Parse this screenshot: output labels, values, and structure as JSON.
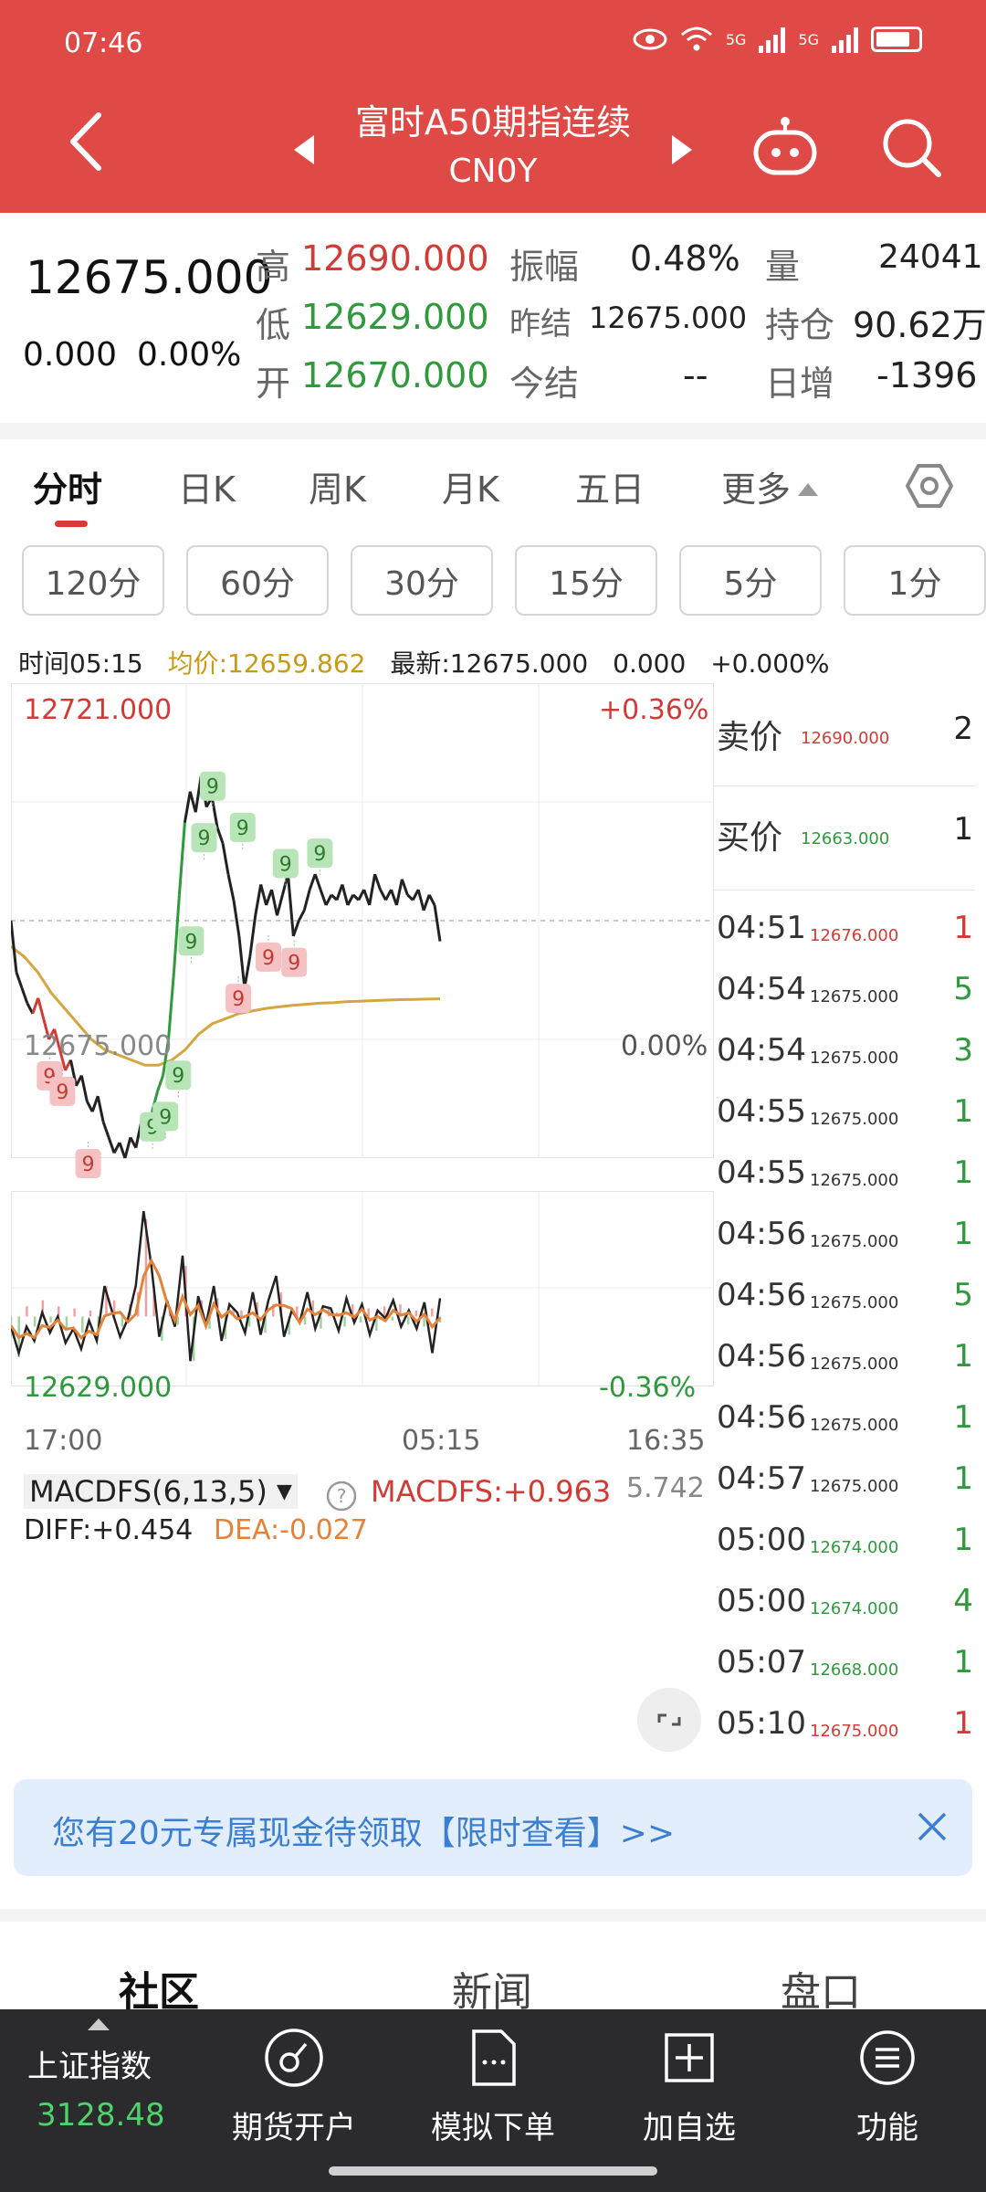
{
  "status_bar": {
    "time": "07:46",
    "net1": "5G",
    "net2": "5G"
  },
  "header": {
    "title": "富时A50期指连续",
    "code": "CN0Y"
  },
  "quote": {
    "last": "12675.000",
    "change": "0.000",
    "change_pct": "0.00%",
    "high_label": "高",
    "high": "12690.000",
    "low_label": "低",
    "low": "12629.000",
    "open_label": "开",
    "open": "12670.000",
    "amp_label": "振幅",
    "amp": "0.48%",
    "prev_settle_label": "昨结",
    "prev_settle": "12675.000",
    "settle_label": "今结",
    "settle": "--",
    "vol_label": "量",
    "vol": "24041",
    "oi_label": "持仓",
    "oi": "90.62万",
    "oi_chg_label": "日增",
    "oi_chg": "-1396"
  },
  "tabs": [
    "分时",
    "日K",
    "周K",
    "月K",
    "五日",
    "更多"
  ],
  "periods": [
    "120分",
    "60分",
    "30分",
    "15分",
    "5分",
    "1分"
  ],
  "info_line": {
    "time": "时间05:15",
    "avg": "均价:12659.862",
    "latest": "最新:12675.000",
    "chg": "0.000",
    "pct": "+0.000%"
  },
  "chart": {
    "price_high": "12721.000",
    "price_mid": "12675.000",
    "price_low": "12629.000",
    "pct_high": "+0.36%",
    "pct_mid": "0.00%",
    "pct_low": "-0.36%",
    "time_start": "17:00",
    "time_mid": "05:15",
    "time_end": "16:35",
    "macd_name": "MACDFS(6,13,5)",
    "macd_val": "MACDFS:+0.963",
    "macd_max": "5.742",
    "diff": "DIFF:+0.454",
    "dea": "DEA:-0.027",
    "marker_label": "9"
  },
  "colors": {
    "up": "#d23a35",
    "down": "#2e9a3c",
    "avg": "#d4a640",
    "macd_line": "#e5823a",
    "header": "#e04a46"
  },
  "chart_data": {
    "type": "line",
    "title": "",
    "xlabel": "",
    "ylabel": "",
    "x_ticks": [
      "17:00",
      "05:15",
      "16:35"
    ],
    "ylim": [
      12629,
      12721
    ],
    "reference": 12675,
    "series": [
      {
        "values": [
          12675,
          12665,
          12662,
          12659,
          12657,
          12660,
          12656,
          12652,
          12654,
          12650,
          12646,
          12648,
          12643,
          12645,
          12640,
          12638,
          12641,
          12636,
          12633,
          12630,
          12632,
          12629,
          12633,
          12631,
          12636,
          12634,
          12638,
          12642,
          12645,
          12652,
          12665,
          12680,
          12694,
          12700,
          12696,
          12703,
          12697,
          12699,
          12693,
          12690,
          12684,
          12679,
          12672,
          12662,
          12668,
          12676,
          12682,
          12678,
          12681,
          12676,
          12680,
          12684,
          12672,
          12675,
          12677,
          12681,
          12684,
          12681,
          12678,
          12680,
          12679,
          12682,
          12678,
          12680,
          12679,
          12681,
          12678,
          12684,
          12681,
          12679,
          12681,
          12678,
          12683,
          12680,
          12679,
          12681,
          12677,
          12680,
          12678,
          12671
        ]
      },
      {
        "values": [
          12670,
          12668,
          12665,
          12661,
          12658,
          12655,
          12652,
          12650,
          12649,
          12648,
          12647,
          12647,
          12648,
          12650,
          12653,
          12655,
          12656,
          12657,
          12657.5,
          12658,
          12658.3,
          12658.6,
          12658.8,
          12659,
          12659.1,
          12659.3,
          12659.4,
          12659.5,
          12659.6,
          12659.7,
          12659.75,
          12659.8,
          12659.86
        ]
      }
    ],
    "tn_markers_up": [
      {
        "t": 0.33,
        "v": 12634
      },
      {
        "t": 0.36,
        "v": 12636
      },
      {
        "t": 0.39,
        "v": 12644
      },
      {
        "t": 0.42,
        "v": 12670
      },
      {
        "t": 0.45,
        "v": 12690
      },
      {
        "t": 0.47,
        "v": 12700
      },
      {
        "t": 0.54,
        "v": 12692
      },
      {
        "t": 0.64,
        "v": 12685
      },
      {
        "t": 0.72,
        "v": 12687
      }
    ],
    "tn_markers_down": [
      {
        "t": 0.09,
        "v": 12646
      },
      {
        "t": 0.12,
        "v": 12643
      },
      {
        "t": 0.18,
        "v": 12629
      },
      {
        "t": 0.53,
        "v": 12661
      },
      {
        "t": 0.6,
        "v": 12669
      },
      {
        "t": 0.66,
        "v": 12668
      }
    ],
    "macd": {
      "ylim": [
        -3,
        5.742
      ],
      "hist": [
        -1,
        -2,
        0.5,
        -0.5,
        0.8,
        -0.3,
        0.5,
        -0.6,
        0.4,
        -0.8,
        0.3,
        -0.5,
        1.5,
        0.8,
        -0.5,
        0.6,
        1.2,
        4.8,
        1.5,
        -1.2,
        0.5,
        -0.4,
        2.5,
        -2.2,
        0.8,
        -0.6,
        0.9,
        -1.1,
        0.4,
        0.3,
        -0.5,
        0.7,
        -0.8,
        0.6,
        1.2,
        -0.9,
        0.5,
        -0.4,
        0.8,
        -0.6,
        0.4,
        0.2,
        -0.5,
        0.6,
        -0.3,
        0.4,
        -0.7,
        0.5,
        -0.2,
        0.6,
        -0.4,
        0.3,
        -0.5,
        0.4,
        -0.3
      ],
      "diff": [
        -0.5,
        -1.8,
        -0.5,
        -1.2,
        0.2,
        -0.8,
        0,
        -1.3,
        -0.6,
        -1.6,
        -0.2,
        -1.2,
        1.5,
        0.2,
        -1,
        -0.1,
        1.5,
        5.2,
        2.5,
        -1,
        0.8,
        -0.5,
        3,
        -2.2,
        1,
        -0.4,
        1.5,
        -1.2,
        0.6,
        0.2,
        -0.8,
        1.2,
        -0.9,
        0.8,
        2,
        -1,
        0.3,
        -0.3,
        1.2,
        -0.6,
        0.5,
        0.4,
        -0.7,
        0.9,
        -0.3,
        0.6,
        -0.9,
        0.3,
        -0.1,
        0.8,
        -0.5,
        0.3,
        -0.6,
        0.7,
        -1.8,
        0.9
      ]
    }
  },
  "order_book": {
    "sell_label": "卖价",
    "sell_price": "12690.000",
    "sell_vol": "2",
    "buy_label": "买价",
    "buy_price": "12663.000",
    "buy_vol": "1",
    "trades": [
      {
        "time": "04:51",
        "price": "12676.000",
        "vol": "1",
        "dir": "up"
      },
      {
        "time": "04:54",
        "price": "12675.000",
        "vol": "5",
        "dir": "down"
      },
      {
        "time": "04:54",
        "price": "12675.000",
        "vol": "3",
        "dir": "down"
      },
      {
        "time": "04:55",
        "price": "12675.000",
        "vol": "1",
        "dir": "down"
      },
      {
        "time": "04:55",
        "price": "12675.000",
        "vol": "1",
        "dir": "down"
      },
      {
        "time": "04:56",
        "price": "12675.000",
        "vol": "1",
        "dir": "down"
      },
      {
        "time": "04:56",
        "price": "12675.000",
        "vol": "5",
        "dir": "down"
      },
      {
        "time": "04:56",
        "price": "12675.000",
        "vol": "1",
        "dir": "down"
      },
      {
        "time": "04:56",
        "price": "12675.000",
        "vol": "1",
        "dir": "down"
      },
      {
        "time": "04:57",
        "price": "12675.000",
        "vol": "1",
        "dir": "down"
      },
      {
        "time": "05:00",
        "price": "12674.000",
        "vol": "1",
        "dir": "down"
      },
      {
        "time": "05:00",
        "price": "12674.000",
        "vol": "4",
        "dir": "down"
      },
      {
        "time": "05:07",
        "price": "12668.000",
        "vol": "1",
        "dir": "down"
      },
      {
        "time": "05:10",
        "price": "12675.000",
        "vol": "1",
        "dir": "up"
      }
    ]
  },
  "banner": {
    "text": "您有20元专属现金待领取【限时查看】>>"
  },
  "bottom_tabs": [
    "社区",
    "新闻",
    "盘口"
  ],
  "nav": {
    "index_name": "上证指数",
    "index_value": "3128.48",
    "items": [
      "期货开户",
      "模拟下单",
      "加自选",
      "功能"
    ]
  }
}
